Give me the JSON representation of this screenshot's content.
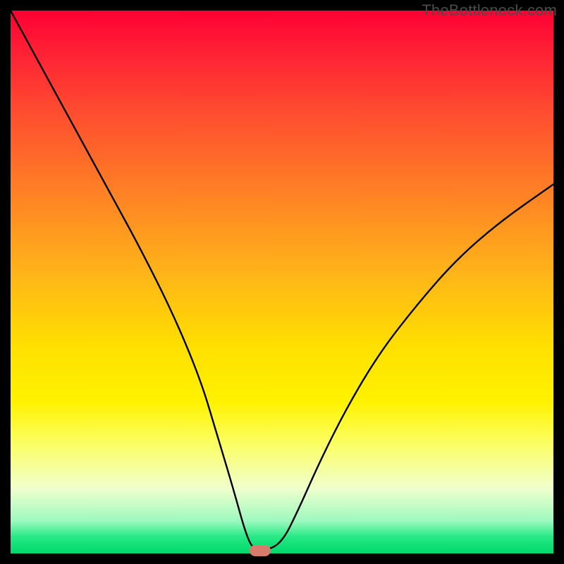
{
  "watermark": "TheBottleneck.com",
  "chart_data": {
    "type": "line",
    "title": "",
    "xlabel": "",
    "ylabel": "",
    "xlim": [
      0,
      100
    ],
    "ylim": [
      0,
      100
    ],
    "x": [
      0,
      6,
      12,
      18,
      24,
      30,
      35,
      38,
      41,
      43.5,
      45,
      47,
      50,
      53,
      57,
      62,
      68,
      75,
      82,
      90,
      100
    ],
    "y": [
      100,
      89,
      78,
      67,
      56,
      44,
      32,
      22,
      12,
      3,
      0.5,
      0.5,
      2,
      8,
      17,
      27,
      37,
      46,
      54,
      61,
      68
    ],
    "marker": {
      "x": 46,
      "y": 0.5
    },
    "background_gradient": {
      "direction": "top-to-bottom",
      "stops": [
        {
          "pos": 0,
          "color": "#ff0033"
        },
        {
          "pos": 18,
          "color": "#ff4a30"
        },
        {
          "pos": 33,
          "color": "#ff7f25"
        },
        {
          "pos": 48,
          "color": "#ffb31a"
        },
        {
          "pos": 72,
          "color": "#fff200"
        },
        {
          "pos": 94,
          "color": "#9df9c0"
        },
        {
          "pos": 100,
          "color": "#00d96a"
        }
      ]
    }
  }
}
